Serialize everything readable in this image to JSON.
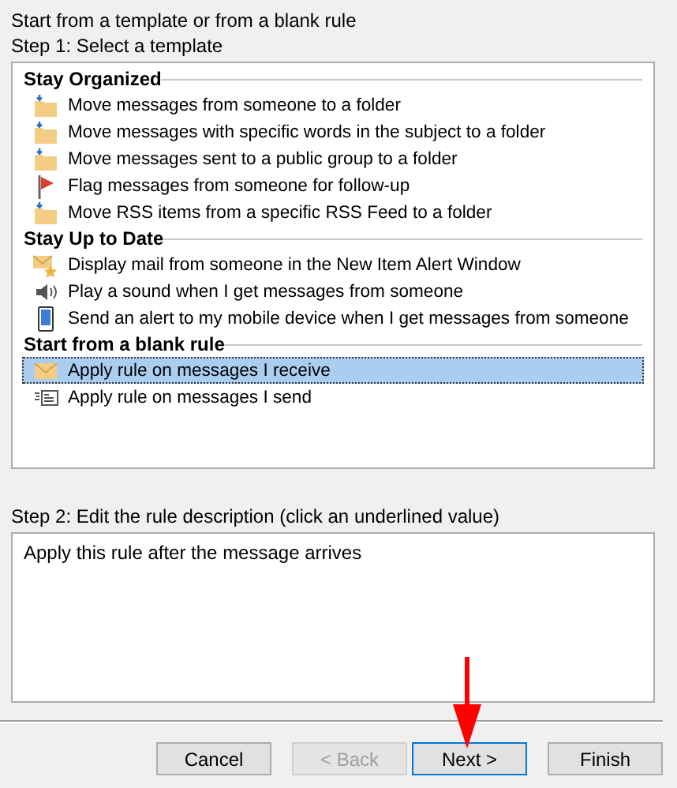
{
  "heading": "Start from a template or from a blank rule",
  "step1_label": "Step 1: Select a template",
  "template_groups": [
    {
      "title": "Stay Organized",
      "items": [
        {
          "label": "Move messages from someone to a folder",
          "kind": "folder",
          "selected": false
        },
        {
          "label": "Move messages with specific words in the subject to a folder",
          "kind": "folder",
          "selected": false
        },
        {
          "label": "Move messages sent to a public group to a folder",
          "kind": "folder",
          "selected": false
        },
        {
          "label": "Flag messages from someone for follow-up",
          "kind": "flag",
          "selected": false
        },
        {
          "label": "Move RSS items from a specific RSS Feed to a folder",
          "kind": "folder",
          "selected": false
        }
      ]
    },
    {
      "title": "Stay Up to Date",
      "items": [
        {
          "label": "Display mail from someone in the New Item Alert Window",
          "kind": "alert",
          "selected": false
        },
        {
          "label": "Play a sound when I get messages from someone",
          "kind": "sound",
          "selected": false
        },
        {
          "label": "Send an alert to my mobile device when I get messages from someone",
          "kind": "mobile",
          "selected": false
        }
      ]
    },
    {
      "title": "Start from a blank rule",
      "items": [
        {
          "label": "Apply rule on messages I receive",
          "kind": "receive",
          "selected": true
        },
        {
          "label": "Apply rule on messages I send",
          "kind": "send",
          "selected": false
        }
      ]
    }
  ],
  "step2_label": "Step 2: Edit the rule description (click an underlined value)",
  "rule_description": "Apply this rule after the message arrives",
  "buttons": [
    {
      "label": "Cancel",
      "disabled": false,
      "default": false
    },
    {
      "label": "< Back",
      "disabled": true,
      "default": false
    },
    {
      "label": "Next >",
      "disabled": false,
      "default": true
    },
    {
      "label": "Finish",
      "disabled": false,
      "default": false
    }
  ]
}
